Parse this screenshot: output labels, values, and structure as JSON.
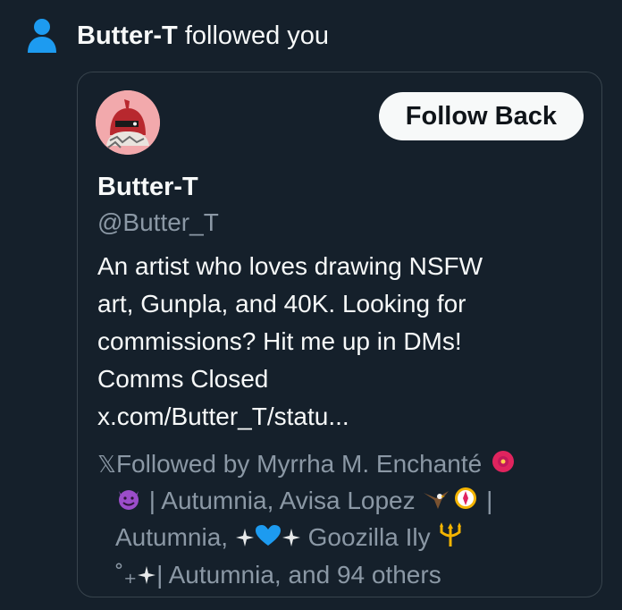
{
  "notification": {
    "actor": "Butter-T",
    "action": " followed you",
    "icon": "person-icon"
  },
  "profile_card": {
    "avatar_icon": "avatar",
    "follow_button_label": "Follow Back",
    "display_name": "Butter-T",
    "handle": "@Butter_T",
    "bio_lines": [
      "An artist who loves drawing NSFW",
      "art, Gunpla, and 40K. Looking for",
      "commissions? Hit me up in DMs!",
      "Comms Closed",
      "x.com/Butter_T/statu..."
    ],
    "followed_by": {
      "x_mark": "𝕏",
      "line1": "Followed by Myrrha M. Enchanté",
      "line2_after_emoji": " | Autumnia, Avisa Lopez ",
      "line2_end": " |",
      "line3_start": "Autumnia, ",
      "line3_mid": " Goozilla Ily ",
      "line4_start": "˚₊",
      "line4_end": "| Autumnia, and 94 others"
    }
  },
  "colors": {
    "background": "#15202b",
    "text": "#f7f9f9",
    "secondary_text": "#8b98a5",
    "accent_blue": "#1d9bf0",
    "card_border": "#38444d",
    "button_bg": "#f7f9f9"
  }
}
